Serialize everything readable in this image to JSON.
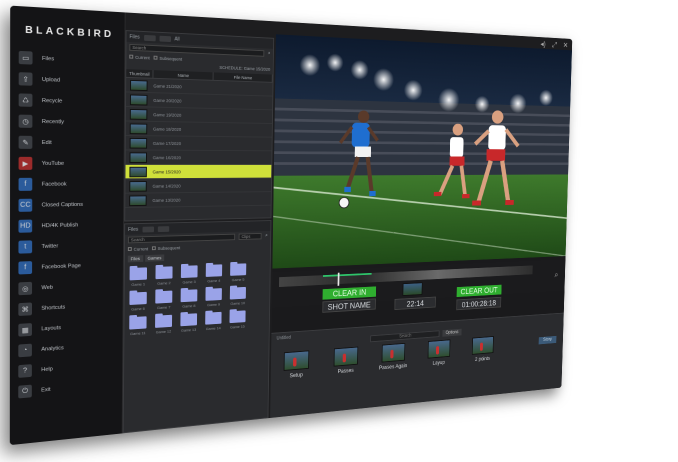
{
  "window": {
    "controls": [
      "speaker-icon",
      "expand-icon",
      "close-icon"
    ]
  },
  "brand": "BLACKBIRD",
  "sidebar": {
    "items": [
      {
        "label": "Files",
        "icon": "folder-icon"
      },
      {
        "label": "Upload",
        "icon": "upload-icon"
      },
      {
        "label": "Recycle",
        "icon": "recycle-icon"
      },
      {
        "label": "Recently",
        "icon": "clock-icon"
      },
      {
        "label": "Edit",
        "icon": "edit-icon"
      },
      {
        "label": "YouTube",
        "icon": "youtube-icon"
      },
      {
        "label": "Facebook",
        "icon": "facebook-icon"
      },
      {
        "label": "Closed Captions",
        "icon": "captions-icon"
      },
      {
        "label": "HD/4K Publish",
        "icon": "hd-icon"
      },
      {
        "label": "Twitter",
        "icon": "twitter-icon"
      },
      {
        "label": "Facebook Page",
        "icon": "facebook-page-icon"
      },
      {
        "label": "Web",
        "icon": "web-icon"
      },
      {
        "label": "Shortcuts",
        "icon": "shortcut-icon"
      },
      {
        "label": "Layouts",
        "icon": "layout-icon"
      },
      {
        "label": "Analytics",
        "icon": "analytics-icon"
      },
      {
        "label": "Help",
        "icon": "help-icon"
      },
      {
        "label": "Exit",
        "icon": "exit-icon"
      }
    ]
  },
  "browser_top": {
    "toolbar": "Files",
    "toggle": "All",
    "search_value": "Search",
    "checks": [
      "Current",
      "Subsequent"
    ],
    "project": "SCHEDULE: Game 15/2020",
    "columns": [
      "Thumbnail",
      "Name",
      "File Name"
    ],
    "rows": [
      {
        "name": "Game 21/2020"
      },
      {
        "name": "Game 20/2020"
      },
      {
        "name": "Game 19/2020"
      },
      {
        "name": "Game 18/2020"
      },
      {
        "name": "Game 17/2020"
      },
      {
        "name": "Game 16/2020"
      },
      {
        "name": "Game 15/2020",
        "selected": true
      },
      {
        "name": "Game 14/2020"
      },
      {
        "name": "Game 13/2020"
      }
    ]
  },
  "browser_bottom": {
    "toolbar": "Files",
    "search_value": "Search",
    "filter": "Clips",
    "checks": [
      "Current",
      "Subsequent"
    ],
    "tabs": [
      "Files",
      "Games"
    ],
    "folders": [
      "Game 1",
      "Game 2",
      "Game 3",
      "Game 4",
      "Game 5",
      "Game 6",
      "Game 7",
      "Game 8",
      "Game 9",
      "Game 10",
      "Game 11",
      "Game 12",
      "Game 13",
      "Game 14",
      "Game 15"
    ]
  },
  "player": {
    "clear_in": "CLEAR IN",
    "shot_name": "SHOT NAME",
    "duration": "22:14",
    "clear_out": "CLEAR OUT",
    "timecode": "01:00:28:18"
  },
  "library": {
    "title": "Untitled",
    "search": "Search",
    "options": "Options",
    "story": "Story",
    "clips": [
      "Setup",
      "Passes",
      "Passes Again",
      "Layup",
      "2 points"
    ]
  }
}
